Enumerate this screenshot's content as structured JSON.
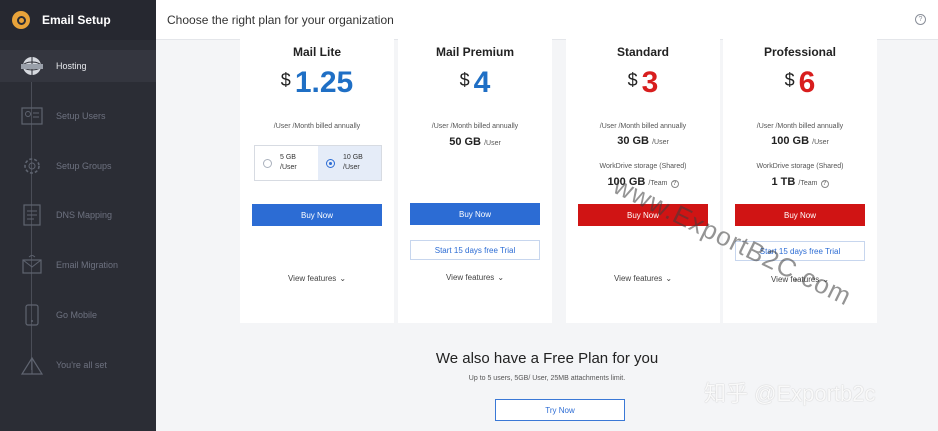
{
  "app": {
    "title": "Email Setup"
  },
  "sidebar": {
    "items": [
      {
        "label": "Hosting",
        "icon": "globe-server-icon",
        "active": true
      },
      {
        "label": "Setup Users",
        "icon": "user-card-icon",
        "active": false
      },
      {
        "label": "Setup Groups",
        "icon": "group-gear-icon",
        "active": false
      },
      {
        "label": "DNS Mapping",
        "icon": "dns-document-icon",
        "active": false
      },
      {
        "label": "Email Migration",
        "icon": "mail-move-icon",
        "active": false
      },
      {
        "label": "Go Mobile",
        "icon": "mobile-icon",
        "active": false
      },
      {
        "label": "You're all set",
        "icon": "flag-tent-icon",
        "active": false
      }
    ]
  },
  "header": {
    "title": "Choose the right plan for your organization",
    "help_icon": "?"
  },
  "plans": [
    {
      "name": "Mail Lite",
      "currency": "$",
      "amount": "1.25",
      "color": "#1f6fc5",
      "billed": "/User /Month billed annually",
      "storage_options": [
        {
          "size": "5 GB",
          "unit": "/User",
          "selected": false
        },
        {
          "size": "10 GB",
          "unit": "/User",
          "selected": true
        }
      ],
      "buy_label": "Buy Now",
      "view_label": "View features"
    },
    {
      "name": "Mail Premium",
      "currency": "$",
      "amount": "4",
      "color": "#1f6fc5",
      "billed": "/User /Month billed annually",
      "storage": "50 GB",
      "storage_unit": "/User",
      "buy_label": "Buy Now",
      "trial_label": "Start 15 days free Trial",
      "view_label": "View features"
    },
    {
      "name": "Standard",
      "currency": "$",
      "amount": "3",
      "color": "#d81e1e",
      "billed": "/User /Month billed annually",
      "storage": "30 GB",
      "storage_unit": "/User",
      "workdrive_label": "WorkDrive storage (Shared)",
      "workdrive": "100 GB",
      "workdrive_unit": "/Team",
      "buy_label": "Buy Now",
      "view_label": "View features"
    },
    {
      "name": "Professional",
      "currency": "$",
      "amount": "6",
      "color": "#d81e1e",
      "billed": "/User /Month billed annually",
      "storage": "100 GB",
      "storage_unit": "/User",
      "workdrive_label": "WorkDrive storage (Shared)",
      "workdrive": "1 TB",
      "workdrive_unit": "/Team",
      "buy_label": "Buy Now",
      "trial_label": "Start 15 days free Trial",
      "view_label": "View features"
    }
  ],
  "free_plan": {
    "title": "We also have a Free Plan for you",
    "subtitle": "Up to 5 users, 5GB/ User, 25MB attachments limit.",
    "button": "Try Now"
  },
  "watermarks": {
    "diagonal": "www.ExportB2C.com",
    "corner": "知乎 @Exportb2c"
  },
  "colors": {
    "sidebar_bg": "#2b2d35",
    "accent_blue": "#2c6cd4",
    "accent_red": "#d01414",
    "logo": "#e8a33a"
  }
}
